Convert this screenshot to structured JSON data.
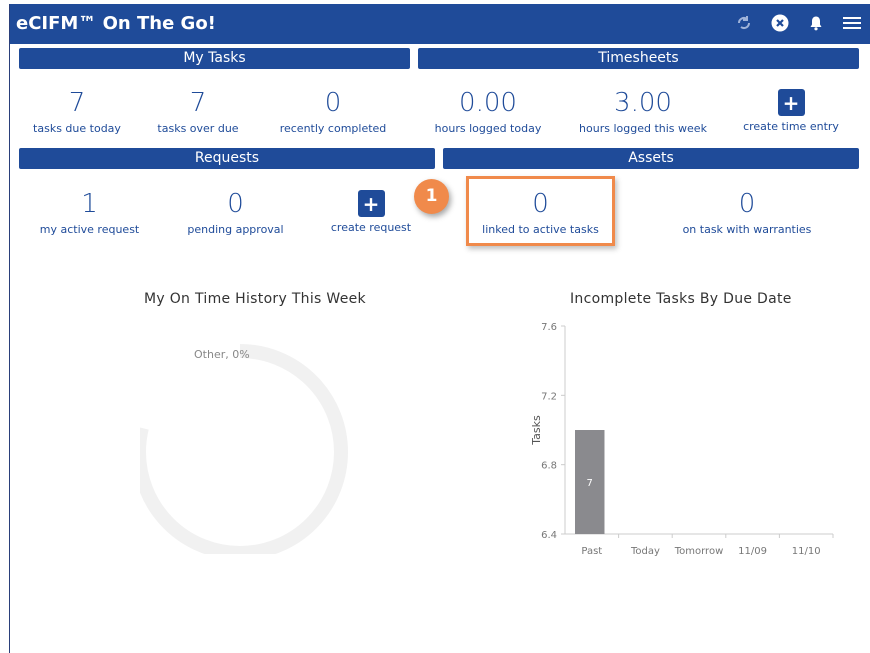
{
  "app": {
    "title": "eCIFM™ On The Go!"
  },
  "sections": {
    "my_tasks": "My Tasks",
    "timesheets": "Timesheets",
    "requests": "Requests",
    "assets": "Assets"
  },
  "my_tasks": [
    {
      "value": "7",
      "label": "tasks due today"
    },
    {
      "value": "7",
      "label": "tasks over due"
    },
    {
      "value": "0",
      "label": "recently completed"
    }
  ],
  "timesheets": [
    {
      "value": "0.00",
      "label": "hours logged today"
    },
    {
      "value": "3.00",
      "label": "hours logged this week"
    },
    {
      "button": "+",
      "label": "create time entry"
    }
  ],
  "requests": [
    {
      "value": "1",
      "label": "my active request"
    },
    {
      "value": "0",
      "label": "pending approval"
    },
    {
      "button": "+",
      "label": "create request"
    }
  ],
  "assets": [
    {
      "value": "0",
      "label": "linked to active tasks"
    },
    {
      "value": "0",
      "label": "on task with warranties"
    }
  ],
  "callout": {
    "number": "1",
    "color": "#f08a4b"
  },
  "donut": {
    "title": "My On Time History This Week",
    "slice_label": "Other, 0%"
  },
  "chart_data": {
    "type": "bar",
    "title": "Incomplete Tasks By Due Date",
    "ylabel": "Tasks",
    "xlabel": "",
    "categories": [
      "Past",
      "Today",
      "Tomorrow",
      "11/09",
      "11/10"
    ],
    "values": [
      7,
      null,
      null,
      null,
      null
    ],
    "data_labels": [
      "7",
      "",
      "",
      "",
      ""
    ],
    "yticks": [
      "6.4",
      "6.8",
      "7.2",
      "7.6"
    ],
    "ylim": [
      6.4,
      7.6
    ],
    "bar_color": "#8a8a8e",
    "grid": false
  },
  "colors": {
    "primary": "#1f4b99",
    "accent": "#f08a4b"
  }
}
